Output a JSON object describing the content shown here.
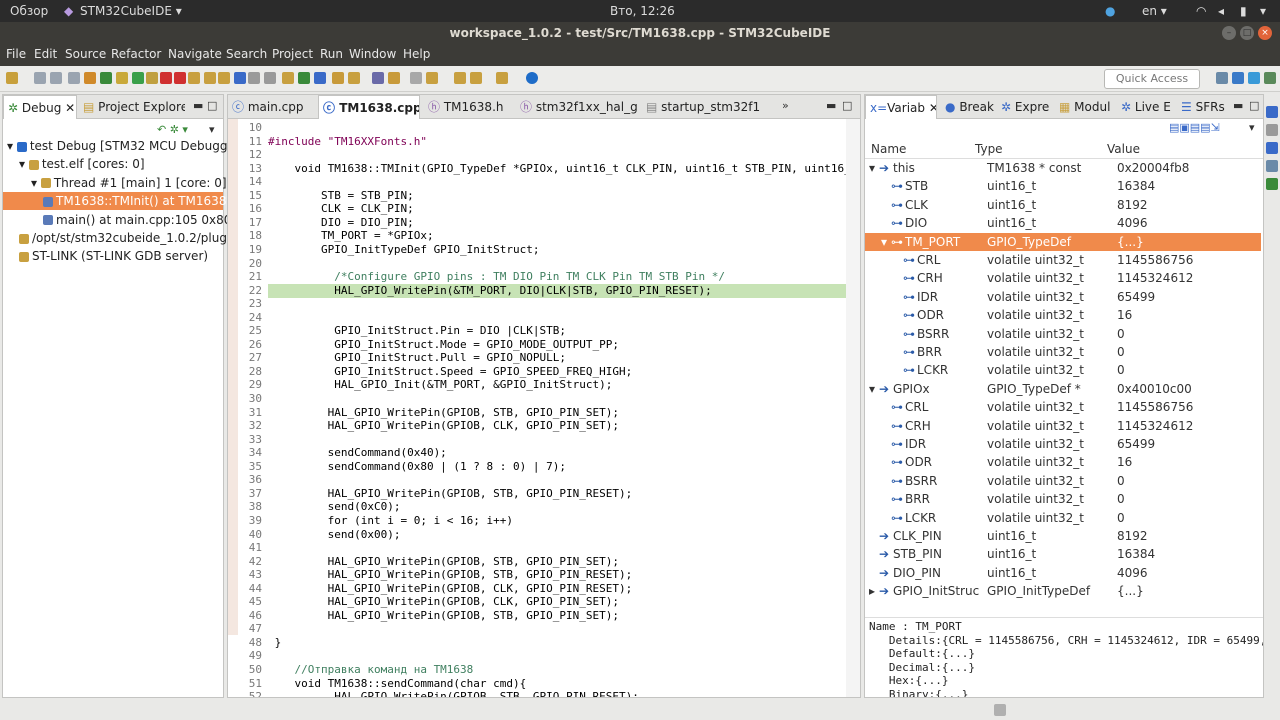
{
  "topbar": {
    "overview": "Обзор",
    "app": "STM32CubeIDE ▾",
    "clock": "Вто, 12:26",
    "lang": "en ▾"
  },
  "window": {
    "title": "workspace_1.0.2 - test/Src/TM1638.cpp - STM32CubeIDE"
  },
  "menu": [
    "File",
    "Edit",
    "Source",
    "Refactor",
    "Navigate",
    "Search",
    "Project",
    "Run",
    "Window",
    "Help"
  ],
  "toolbar": {
    "quick_access_placeholder": "Quick Access"
  },
  "debug_view": {
    "tabs": [
      "Debug",
      "Project Explore"
    ],
    "tree": [
      {
        "label": "test Debug [STM32 MCU Debugging]",
        "indent": 0,
        "icon": "ide-icon"
      },
      {
        "label": "test.elf [cores: 0]",
        "indent": 1,
        "icon": "elf-icon"
      },
      {
        "label": "Thread #1 [main] 1 [core: 0] (Su",
        "indent": 2,
        "icon": "thread-icon"
      },
      {
        "label": "TM1638::TMInit() at TM1638.c",
        "indent": 3,
        "icon": "stack-frame-icon",
        "selected": true
      },
      {
        "label": "main() at main.cpp:105 0x800",
        "indent": 3,
        "icon": "stack-frame-icon"
      },
      {
        "label": "/opt/st/stm32cubeide_1.0.2/plug",
        "indent": 1,
        "icon": "process-icon"
      },
      {
        "label": "ST-LINK (ST-LINK GDB server)",
        "indent": 1,
        "icon": "process-icon"
      }
    ]
  },
  "editor": {
    "tabs": [
      "main.cpp",
      "TM1638.cpp",
      "TM1638.h",
      "stm32f1xx_hal_g",
      "startup_stm32f1"
    ],
    "active_tab": 1,
    "line_numbers": [
      "10",
      "11",
      "12",
      "13",
      "14",
      "15",
      "16",
      "17",
      "18",
      "19",
      "20",
      "21",
      "22",
      "23",
      "24",
      "25",
      "26",
      "27",
      "28",
      "29",
      "30",
      "31",
      "32",
      "33",
      "34",
      "35",
      "36",
      "37",
      "38",
      "39",
      "40",
      "41",
      "42",
      "43",
      "44",
      "45",
      "46",
      "47",
      "48",
      "49",
      "50",
      "51",
      "52"
    ],
    "lines": [
      "",
      "#include \"TM16XXFonts.h\"",
      "",
      "    void TM1638::TMInit(GPIO_TypeDef *GPIOx, uint16_t CLK_PIN, uint16_t STB_PIN, uint16_t D",
      "",
      "        STB = STB_PIN;",
      "        CLK = CLK_PIN;",
      "        DIO = DIO_PIN;",
      "        TM_PORT = *GPIOx;",
      "        GPIO_InitTypeDef GPIO_InitStruct;",
      "",
      "          /*Configure GPIO pins : TM DIO Pin TM CLK Pin TM STB Pin */",
      "          HAL_GPIO_WritePin(&TM_PORT, DIO|CLK|STB, GPIO_PIN_RESET);",
      "",
      "",
      "          GPIO_InitStruct.Pin = DIO |CLK|STB;",
      "          GPIO_InitStruct.Mode = GPIO_MODE_OUTPUT_PP;",
      "          GPIO_InitStruct.Pull = GPIO_NOPULL;",
      "          GPIO_InitStruct.Speed = GPIO_SPEED_FREQ_HIGH;",
      "          HAL_GPIO_Init(&TM_PORT, &GPIO_InitStruct);",
      "",
      "         HAL_GPIO_WritePin(GPIOB, STB, GPIO_PIN_SET);",
      "         HAL_GPIO_WritePin(GPIOB, CLK, GPIO_PIN_SET);",
      "",
      "         sendCommand(0x40);",
      "         sendCommand(0x80 | (1 ? 8 : 0) | 7);",
      "",
      "         HAL_GPIO_WritePin(GPIOB, STB, GPIO_PIN_RESET);",
      "         send(0xC0);",
      "         for (int i = 0; i < 16; i++)",
      "         send(0x00);",
      "",
      "         HAL_GPIO_WritePin(GPIOB, STB, GPIO_PIN_SET);",
      "         HAL_GPIO_WritePin(GPIOB, STB, GPIO_PIN_RESET);",
      "         HAL_GPIO_WritePin(GPIOB, CLK, GPIO_PIN_RESET);",
      "         HAL_GPIO_WritePin(GPIOB, CLK, GPIO_PIN_SET);",
      "         HAL_GPIO_WritePin(GPIOB, STB, GPIO_PIN_SET);",
      "",
      " }",
      "",
      "    //Отправка команд на TM1638",
      "    void TM1638::sendCommand(char cmd){",
      "          HAL_GPIO_WritePin(GPIOB, STB, GPIO_PIN_RESET);"
    ],
    "current_line_index": 12
  },
  "variables_view": {
    "tabs": [
      "Variab",
      "Break",
      "Expre",
      "Modul",
      "Live E",
      "SFRs"
    ],
    "columns": [
      "Name",
      "Type",
      "Value"
    ],
    "rows": [
      {
        "name": "this",
        "type": "TM1638 * const",
        "value": "0x20004fb8",
        "indent": 0,
        "expand": "▾"
      },
      {
        "name": "STB",
        "type": "uint16_t",
        "value": "16384",
        "indent": 1,
        "expand": ""
      },
      {
        "name": "CLK",
        "type": "uint16_t",
        "value": "8192",
        "indent": 1,
        "expand": ""
      },
      {
        "name": "DIO",
        "type": "uint16_t",
        "value": "4096",
        "indent": 1,
        "expand": ""
      },
      {
        "name": "TM_PORT",
        "type": "GPIO_TypeDef",
        "value": "{...}",
        "indent": 1,
        "expand": "▾",
        "selected": true
      },
      {
        "name": "CRL",
        "type": "volatile uint32_t",
        "value": "1145586756",
        "indent": 2,
        "expand": ""
      },
      {
        "name": "CRH",
        "type": "volatile uint32_t",
        "value": "1145324612",
        "indent": 2,
        "expand": ""
      },
      {
        "name": "IDR",
        "type": "volatile uint32_t",
        "value": "65499",
        "indent": 2,
        "expand": ""
      },
      {
        "name": "ODR",
        "type": "volatile uint32_t",
        "value": "16",
        "indent": 2,
        "expand": ""
      },
      {
        "name": "BSRR",
        "type": "volatile uint32_t",
        "value": "0",
        "indent": 2,
        "expand": ""
      },
      {
        "name": "BRR",
        "type": "volatile uint32_t",
        "value": "0",
        "indent": 2,
        "expand": ""
      },
      {
        "name": "LCKR",
        "type": "volatile uint32_t",
        "value": "0",
        "indent": 2,
        "expand": ""
      },
      {
        "name": "GPIOx",
        "type": "GPIO_TypeDef *",
        "value": "0x40010c00",
        "indent": 0,
        "expand": "▾"
      },
      {
        "name": "CRL",
        "type": "volatile uint32_t",
        "value": "1145586756",
        "indent": 1,
        "expand": ""
      },
      {
        "name": "CRH",
        "type": "volatile uint32_t",
        "value": "1145324612",
        "indent": 1,
        "expand": ""
      },
      {
        "name": "IDR",
        "type": "volatile uint32_t",
        "value": "65499",
        "indent": 1,
        "expand": ""
      },
      {
        "name": "ODR",
        "type": "volatile uint32_t",
        "value": "16",
        "indent": 1,
        "expand": ""
      },
      {
        "name": "BSRR",
        "type": "volatile uint32_t",
        "value": "0",
        "indent": 1,
        "expand": ""
      },
      {
        "name": "BRR",
        "type": "volatile uint32_t",
        "value": "0",
        "indent": 1,
        "expand": ""
      },
      {
        "name": "LCKR",
        "type": "volatile uint32_t",
        "value": "0",
        "indent": 1,
        "expand": ""
      },
      {
        "name": "CLK_PIN",
        "type": "uint16_t",
        "value": "8192",
        "indent": 0,
        "expand": ""
      },
      {
        "name": "STB_PIN",
        "type": "uint16_t",
        "value": "16384",
        "indent": 0,
        "expand": ""
      },
      {
        "name": "DIO_PIN",
        "type": "uint16_t",
        "value": "4096",
        "indent": 0,
        "expand": ""
      },
      {
        "name": "GPIO_InitStruc",
        "type": "GPIO_InitTypeDef",
        "value": "{...}",
        "indent": 0,
        "expand": "▸"
      }
    ],
    "details": [
      "Name : TM_PORT",
      "   Details:{CRL = 1145586756, CRH = 1145324612, IDR = 65499,",
      "   Default:{...}",
      "   Decimal:{...}",
      "   Hex:{...}",
      "   Binary:{...}"
    ]
  },
  "colors": {
    "selection": "#f08a4b",
    "current_line": "#c7e3b5",
    "accent": "#dd4814"
  }
}
